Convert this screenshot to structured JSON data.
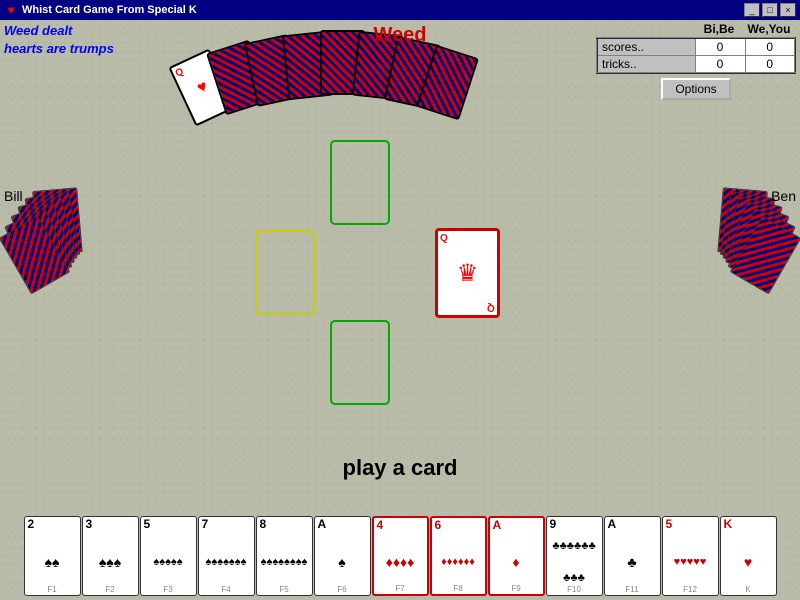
{
  "titleBar": {
    "title": "Whist Card Game From Special K",
    "icon": "♥",
    "buttons": [
      "_",
      "□",
      "×"
    ]
  },
  "infoLeft": {
    "line1": "Weed dealt",
    "line2": "hearts are trumps"
  },
  "weedLabel": "Weed",
  "players": {
    "bill": "Bill",
    "ben": "Ben"
  },
  "scoreHeader": {
    "label": "",
    "bi": "Bi,Be",
    "we": "We,You"
  },
  "scoreRows": [
    {
      "label": "scores..",
      "bi": "0",
      "we": "0"
    },
    {
      "label": "tricks..",
      "bi": "0",
      "we": "0"
    }
  ],
  "optionsButton": "Options",
  "playText": "play a card",
  "playerHand": [
    {
      "rank": "2",
      "suit": "♠",
      "color": "black",
      "fn": "F1",
      "highlight": false
    },
    {
      "rank": "3",
      "suit": "♠",
      "color": "black",
      "fn": "F2",
      "highlight": false
    },
    {
      "rank": "5",
      "suit": "♠",
      "color": "black",
      "fn": "F3",
      "highlight": false
    },
    {
      "rank": "7",
      "suit": "♠",
      "color": "black",
      "fn": "F4",
      "highlight": false
    },
    {
      "rank": "8",
      "suit": "♠",
      "color": "black",
      "fn": "F5",
      "highlight": false
    },
    {
      "rank": "A",
      "suit": "♠",
      "color": "black",
      "fn": "F6",
      "highlight": false
    },
    {
      "rank": "4",
      "suit": "♦",
      "color": "red",
      "fn": "F7",
      "highlight": true
    },
    {
      "rank": "6",
      "suit": "♦",
      "color": "red",
      "fn": "F8",
      "highlight": true
    },
    {
      "rank": "A",
      "suit": "♦",
      "color": "red",
      "fn": "F9",
      "highlight": true
    },
    {
      "rank": "9",
      "suit": "♣",
      "color": "black",
      "fn": "F10",
      "highlight": false
    },
    {
      "rank": "A",
      "suit": "♣",
      "color": "black",
      "fn": "F11",
      "highlight": false
    },
    {
      "rank": "5",
      "suit": "♥",
      "color": "red",
      "fn": "F12",
      "highlight": false
    },
    {
      "rank": "K",
      "suit": "♥",
      "color": "red",
      "fn": "K",
      "highlight": false
    }
  ]
}
